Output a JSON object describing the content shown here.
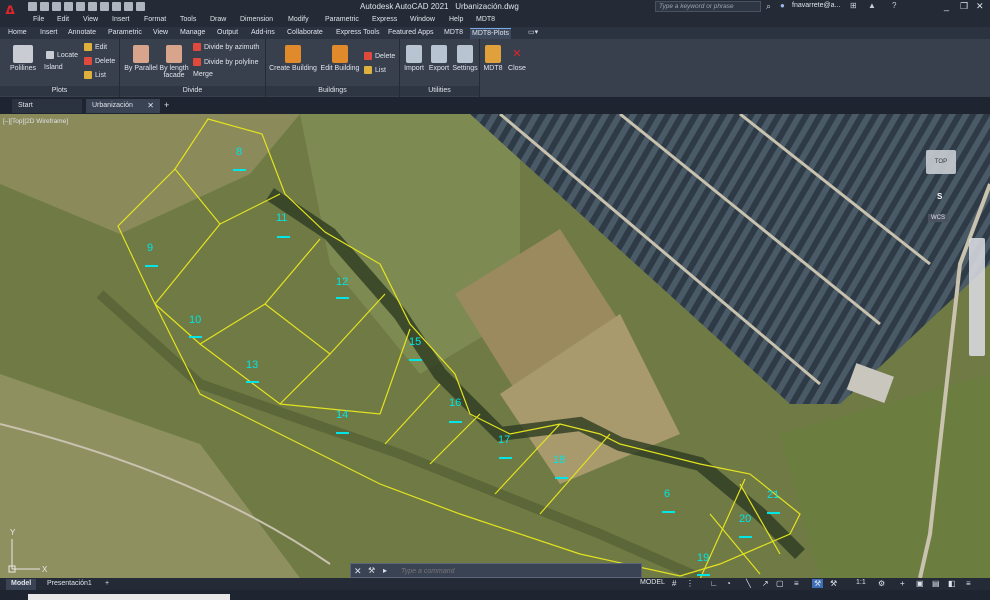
{
  "app": {
    "logo": "A",
    "title": "Autodesk AutoCAD 2021",
    "filename": "Urbanización.dwg",
    "search_placeholder": "Type a keyword or phrase",
    "user": "fnavarrete@a...",
    "win_min": "_",
    "win_restore": "❐",
    "win_close": "✕"
  },
  "menu": [
    "File",
    "Edit",
    "View",
    "Insert",
    "Format",
    "Tools",
    "Draw",
    "Dimension",
    "Modify",
    "Parametric",
    "Express",
    "Window",
    "Help",
    "MDT8"
  ],
  "ribbon_tabs": [
    "Home",
    "Insert",
    "Annotate",
    "Parametric",
    "View",
    "Manage",
    "Output",
    "Add-ins",
    "Collaborate",
    "Express Tools",
    "Featured Apps",
    "MDT8",
    "MDT8-Plots"
  ],
  "ribbon": {
    "plots": {
      "label": "Plots",
      "polilines": "Polilines",
      "locate": "Locate",
      "island": "Island",
      "edit": "Edit",
      "delete": "Delete",
      "list": "List"
    },
    "divide": {
      "label": "Divide",
      "by_parallel": "By Parallel",
      "by_length_1": "By length",
      "by_length_2": "facade",
      "by_azimuth": "Divide by azimuth",
      "by_polyline": "Divide by polyline",
      "merge": "Merge"
    },
    "buildings": {
      "label": "Buildings",
      "create": "Create Building",
      "edit": "Edit Building",
      "delete": "Delete",
      "list": "List"
    },
    "utilities": {
      "label": "Utilities",
      "import": "Import",
      "export": "Export",
      "settings": "Settings"
    },
    "mdt8": {
      "mdt8": "MDT8",
      "close": "Close"
    }
  },
  "file_tabs": {
    "start": "Start",
    "drawing": "Urbanización",
    "close": "✕",
    "add": "+"
  },
  "viewport": {
    "view_label": "[–][Top][2D Wireframe]",
    "viewcube": "TOP",
    "compass": "S",
    "wcs": "WCS",
    "parcels": [
      "8",
      "9",
      "11",
      "12",
      "10",
      "15",
      "13",
      "14",
      "16",
      "17",
      "18",
      "6",
      "21",
      "20",
      "19"
    ],
    "ucs_y": "Y",
    "ucs_x": "X"
  },
  "command": {
    "close": "✕",
    "wrench": "🔧",
    "prompt_icon": "▸",
    "placeholder": "Type a command"
  },
  "status": {
    "tab_model": "Model",
    "tab_layout": "Presentación1",
    "tab_add": "+",
    "model": "MODEL",
    "scale": "1:1"
  },
  "colors": {
    "parcel_line": "#e3e31f",
    "parcel_label": "#00e5e5",
    "accent": "#7aa7e6"
  }
}
